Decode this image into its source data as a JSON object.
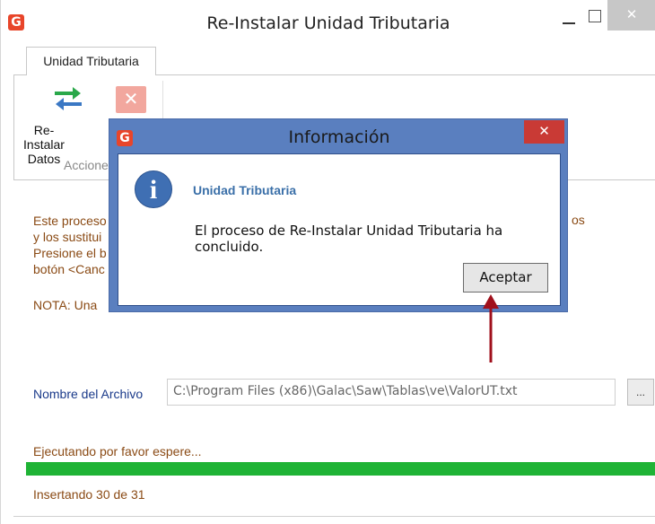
{
  "window": {
    "title": "Re-Instalar Unidad Tributaria",
    "logo_text": "G",
    "close_glyph": "✕"
  },
  "ribbon": {
    "tab_label": "Unidad Tributaria",
    "reinstall_label_line1": "Re-Instalar",
    "reinstall_label_line2": "Datos",
    "cancel_glyph": "✕",
    "group_label": "Acciones"
  },
  "body": {
    "desc_lines": [
      "Este proceso",
      "y los sustitui",
      "Presione el b",
      "botón <Canc"
    ],
    "desc_extra": "os",
    "nota": "NOTA: Una",
    "file_label": "Nombre del Archivo",
    "file_value": "C:\\Program Files (x86)\\Galac\\Saw\\Tablas\\ve\\ValorUT.txt",
    "browse_label": "...",
    "status": "Ejecutando por favor espere...",
    "progress_fraction": 1.0,
    "progress_text": "Insertando 30 de 31"
  },
  "dialog": {
    "title": "Información",
    "logo_text": "G",
    "close_glyph": "✕",
    "info_glyph": "i",
    "heading": "Unidad Tributaria",
    "message": "El proceso de Re-Instalar Unidad Tributaria ha concluido.",
    "ok_label": "Aceptar"
  },
  "colors": {
    "progress": "#1fb335",
    "dialog_frame": "#5a7fbf",
    "annotation_arrow": "#a0101c"
  },
  "icons": {
    "reinstall": "swap-arrows-icon",
    "cancel": "cancel-x-icon",
    "info": "info-icon"
  }
}
